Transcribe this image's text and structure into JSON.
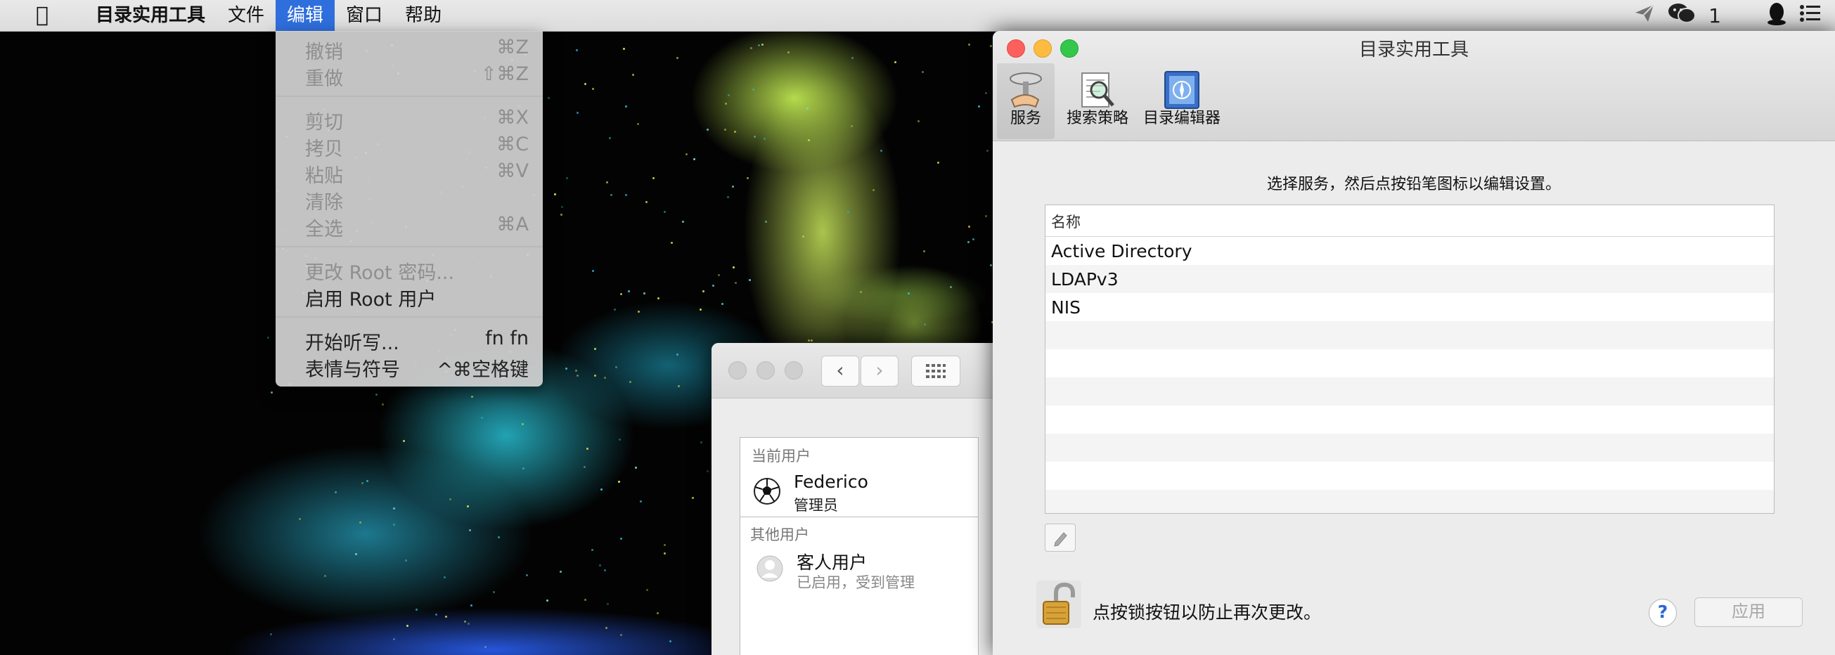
{
  "menubar": {
    "app_name": "目录实用工具",
    "items": [
      "文件",
      "编辑",
      "窗口",
      "帮助"
    ],
    "status": {
      "wechat_count": "1"
    }
  },
  "edit_menu": {
    "undo": {
      "label": "撤销",
      "shortcut": "⌘Z"
    },
    "redo": {
      "label": "重做",
      "shortcut": "⇧⌘Z"
    },
    "cut": {
      "label": "剪切",
      "shortcut": "⌘X"
    },
    "copy": {
      "label": "拷贝",
      "shortcut": "⌘C"
    },
    "paste": {
      "label": "粘贴",
      "shortcut": "⌘V"
    },
    "clear": {
      "label": "清除"
    },
    "select_all": {
      "label": "全选",
      "shortcut": "⌘A"
    },
    "change_root_password": {
      "label": "更改 Root 密码..."
    },
    "enable_root_user": {
      "label": "启用 Root 用户"
    },
    "start_dictation": {
      "label": "开始听写...",
      "shortcut": "fn fn"
    },
    "emoji_symbols": {
      "label": "表情与符号",
      "shortcut": "^⌘空格键"
    }
  },
  "users_window": {
    "current_user_header": "当前用户",
    "current_user_name": "Federico",
    "current_user_role": "管理员",
    "other_users_header": "其他用户",
    "guest_name": "客人用户",
    "guest_status": "已启用，受到管理"
  },
  "directory_window": {
    "title": "目录实用工具",
    "toolbar": [
      {
        "label": "服务",
        "icon": "services-icon"
      },
      {
        "label": "搜索策略",
        "icon": "search-policy-icon"
      },
      {
        "label": "目录编辑器",
        "icon": "directory-editor-icon"
      }
    ],
    "instruction": "选择服务，然后点按铅笔图标以编辑设置。",
    "table_header": "名称",
    "services": [
      "Active Directory",
      "LDAPv3",
      "NIS"
    ],
    "lock_text": "点按锁按钮以防止再次更改。",
    "help_label": "?",
    "apply_label": "应用"
  },
  "colors": {
    "menu_highlight": "#2f6fdd",
    "close": "#fc605c",
    "minimize": "#fdbc40",
    "zoom": "#34c84a"
  }
}
